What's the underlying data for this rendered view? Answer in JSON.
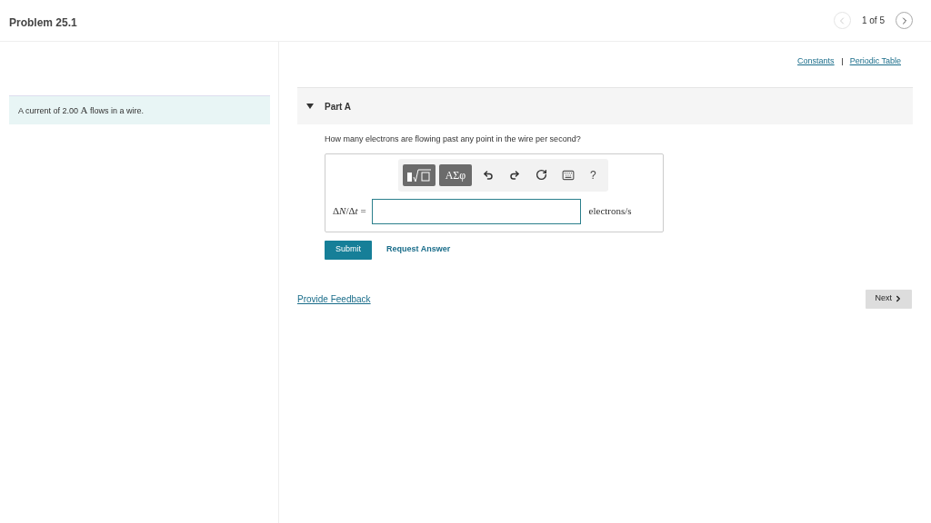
{
  "header": {
    "title": "Problem 25.1",
    "pager": {
      "text": "1 of 5",
      "prev_disabled": true,
      "next_disabled": false
    }
  },
  "intro": {
    "before": "A current of 2.00 ",
    "unit": "A",
    "after": " flows in a wire."
  },
  "links": [
    "Constants",
    "Periodic Table"
  ],
  "part": {
    "title": "Part A",
    "expanded": true,
    "question": "How many electrons are flowing past any point in the wire per second?",
    "toolbar": {
      "symbols": "ΑΣφ",
      "help": "?"
    },
    "label": [
      {
        "text": "Δ",
        "italic": false
      },
      {
        "text": "N",
        "italic": true
      },
      {
        "text": "/Δ",
        "italic": false
      },
      {
        "text": "t",
        "italic": true
      },
      {
        "text": " =",
        "italic": false
      }
    ],
    "units": "electrons/s",
    "submit": "Submit",
    "request": "Request Answer"
  },
  "feedback": "Provide Feedback",
  "next": "Next"
}
